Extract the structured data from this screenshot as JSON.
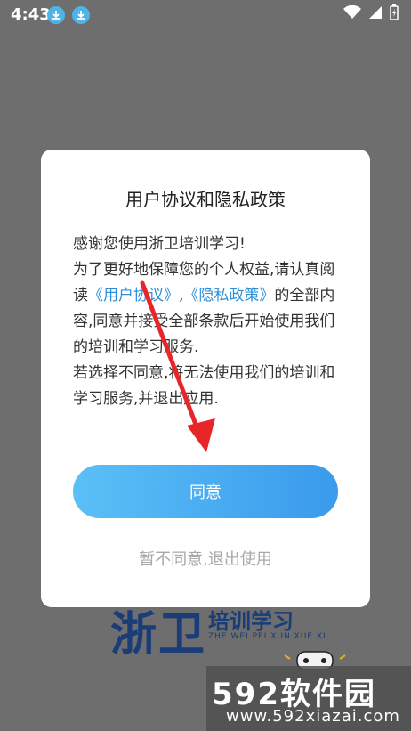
{
  "status_bar": {
    "time": "4:43",
    "notification_icons": [
      "download-icon",
      "download-icon"
    ],
    "right_icons": [
      "wifi-icon",
      "signal-icon",
      "battery-charging-icon"
    ]
  },
  "background": {
    "logo_mark": "浙卫",
    "logo_cn": "培训学习",
    "logo_en": "ZHE WEI PEI XUN XUE XI"
  },
  "dialog": {
    "title": "用户协议和隐私政策",
    "greeting": "感谢您使用浙卫培训学习!",
    "para1_before": "为了更好地保障您的个人权益,请认真阅读",
    "link_user_agreement": "《用户协议》",
    "comma": ",",
    "link_privacy_policy": "《隐私政策》",
    "para1_after": "的全部内容,同意并接受全部条款后开始使用我们的培训和学习服务.",
    "para2": "若选择不同意,将无法使用我们的培训和学习服务,并退出应用.",
    "agree_label": "同意",
    "disagree_label": "暂不同意,退出使用"
  },
  "watermark": {
    "main_num": "592",
    "main_text": "软件园",
    "url": "www.592xiazai.com"
  },
  "colors": {
    "overlay": "#6e6e6e",
    "link": "#2f8fd8",
    "button_start": "#5bc0f6",
    "button_end": "#3a9aed",
    "annotation": "#e8262a"
  }
}
